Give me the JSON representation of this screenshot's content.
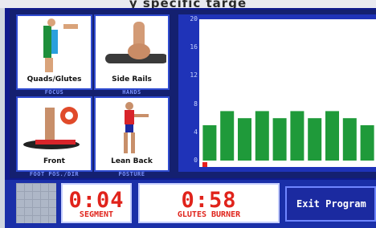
{
  "top_caption": "y specific targe",
  "tiles": [
    {
      "label": "Quads/Glutes",
      "caption": "FOCUS"
    },
    {
      "label": "Side Rails",
      "caption": "HANDS"
    },
    {
      "label": "Front",
      "caption": "FOOT POS./DIR"
    },
    {
      "label": "Lean Back",
      "caption": "POSTURE"
    }
  ],
  "chart_data": {
    "type": "bar",
    "y_ticks": [
      "20",
      "16",
      "12",
      "8",
      "4",
      "0"
    ],
    "values": [
      5,
      7,
      6,
      7,
      6,
      7,
      6,
      7,
      6,
      5
    ],
    "ylim": [
      0,
      20
    ],
    "bar_color": "#1f9a3a"
  },
  "timers": [
    {
      "value": "0:04",
      "label": "SEGMENT"
    },
    {
      "value": "0:58",
      "label": "GLUTES BURNER"
    }
  ],
  "exit_button": {
    "label": "Exit Program"
  }
}
